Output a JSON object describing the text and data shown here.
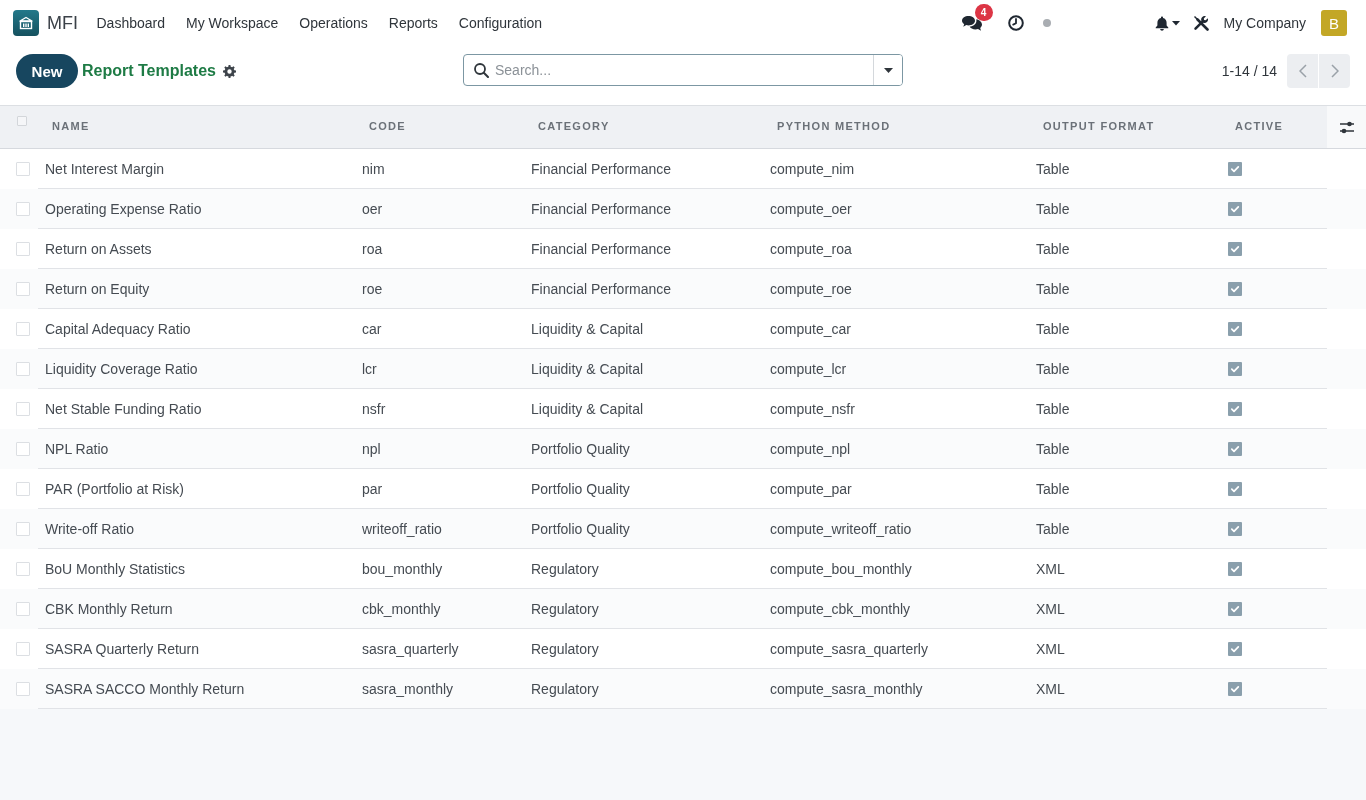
{
  "navbar": {
    "app_name": "MFI",
    "menu": [
      "Dashboard",
      "My Workspace",
      "Operations",
      "Reports",
      "Configuration"
    ],
    "message_count": "4",
    "company": "My Company",
    "avatar_initial": "B"
  },
  "control_panel": {
    "new_button": "New",
    "title": "Report Templates",
    "search": {
      "placeholder": "Search..."
    },
    "pager": "1-14 / 14"
  },
  "table": {
    "select_all": {
      "checked": false
    },
    "columns": [
      "NAME",
      "CODE",
      "CATEGORY",
      "PYTHON METHOD",
      "OUTPUT FORMAT",
      "ACTIVE"
    ],
    "rows": [
      {
        "name": "Net Interest Margin",
        "code": "nim",
        "category": "Financial Performance",
        "python_method": "compute_nim",
        "output_format": "Table",
        "active": true,
        "selected": false
      },
      {
        "name": "Operating Expense Ratio",
        "code": "oer",
        "category": "Financial Performance",
        "python_method": "compute_oer",
        "output_format": "Table",
        "active": true,
        "selected": false
      },
      {
        "name": "Return on Assets",
        "code": "roa",
        "category": "Financial Performance",
        "python_method": "compute_roa",
        "output_format": "Table",
        "active": true,
        "selected": false
      },
      {
        "name": "Return on Equity",
        "code": "roe",
        "category": "Financial Performance",
        "python_method": "compute_roe",
        "output_format": "Table",
        "active": true,
        "selected": false
      },
      {
        "name": "Capital Adequacy Ratio",
        "code": "car",
        "category": "Liquidity & Capital",
        "python_method": "compute_car",
        "output_format": "Table",
        "active": true,
        "selected": false
      },
      {
        "name": "Liquidity Coverage Ratio",
        "code": "lcr",
        "category": "Liquidity & Capital",
        "python_method": "compute_lcr",
        "output_format": "Table",
        "active": true,
        "selected": false
      },
      {
        "name": "Net Stable Funding Ratio",
        "code": "nsfr",
        "category": "Liquidity & Capital",
        "python_method": "compute_nsfr",
        "output_format": "Table",
        "active": true,
        "selected": false
      },
      {
        "name": "NPL Ratio",
        "code": "npl",
        "category": "Portfolio Quality",
        "python_method": "compute_npl",
        "output_format": "Table",
        "active": true,
        "selected": false
      },
      {
        "name": "PAR (Portfolio at Risk)",
        "code": "par",
        "category": "Portfolio Quality",
        "python_method": "compute_par",
        "output_format": "Table",
        "active": true,
        "selected": false
      },
      {
        "name": "Write-off Ratio",
        "code": "writeoff_ratio",
        "category": "Portfolio Quality",
        "python_method": "compute_writeoff_ratio",
        "output_format": "Table",
        "active": true,
        "selected": false
      },
      {
        "name": "BoU Monthly Statistics",
        "code": "bou_monthly",
        "category": "Regulatory",
        "python_method": "compute_bou_monthly",
        "output_format": "XML",
        "active": true,
        "selected": false
      },
      {
        "name": "CBK Monthly Return",
        "code": "cbk_monthly",
        "category": "Regulatory",
        "python_method": "compute_cbk_monthly",
        "output_format": "XML",
        "active": true,
        "selected": false
      },
      {
        "name": "SASRA Quarterly Return",
        "code": "sasra_quarterly",
        "category": "Regulatory",
        "python_method": "compute_sasra_quarterly",
        "output_format": "XML",
        "active": true,
        "selected": false
      },
      {
        "name": "SASRA SACCO Monthly Return",
        "code": "sasra_monthly",
        "category": "Regulatory",
        "python_method": "compute_sasra_monthly",
        "output_format": "XML",
        "active": true,
        "selected": false
      }
    ]
  }
}
